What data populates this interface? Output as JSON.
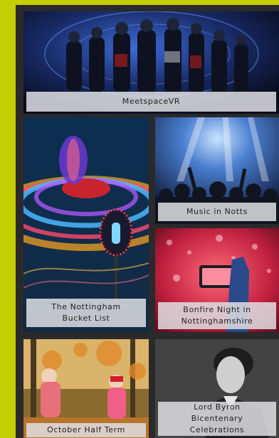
{
  "tiles": {
    "meetspace": {
      "label": "MeetspaceVR"
    },
    "bucket_list": {
      "label": "The Nottingham\nBucket List"
    },
    "music": {
      "label": "Music in Notts"
    },
    "bonfire": {
      "label": "Bonfire Night in\nNottinghamshire"
    },
    "half_term": {
      "label": "October Half Term"
    },
    "byron": {
      "label": "Lord Byron\nBicentenary\nCelebrations"
    }
  },
  "colors": {
    "page_background": "#c4cf06",
    "frame_background": "#2a2a2c",
    "caption_background": "#dedee2"
  }
}
